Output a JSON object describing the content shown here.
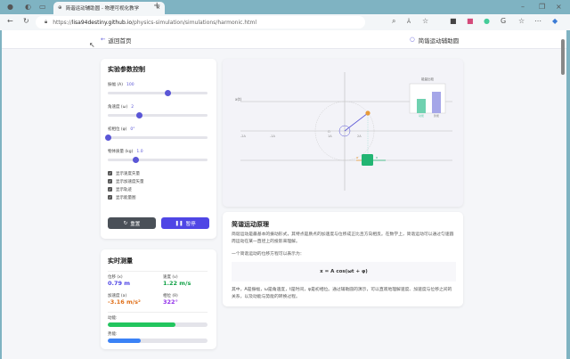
{
  "browser": {
    "tab_title": "简谐运动辅助圆 - 物理可视化教学",
    "url_prefix": "https://",
    "url_host": "lisa94destiny.github.io",
    "url_path": "/physics-simulation/simulations/harmonic.html"
  },
  "header": {
    "back_label": "返回首页",
    "title": "简谐运动辅助圆"
  },
  "controls": {
    "title": "实验参数控制",
    "sliders": [
      {
        "label": "振幅 (A)",
        "value": "100",
        "fraction": 0.6
      },
      {
        "label": "角速度 (ω)",
        "value": "2",
        "fraction": 0.32
      },
      {
        "label": "初相位 (φ)",
        "value": "0°",
        "fraction": 0.0
      },
      {
        "label": "物体质量 (kg)",
        "value": "1.0",
        "fraction": 0.28
      }
    ],
    "checkboxes": [
      {
        "label": "显示速度矢量",
        "checked": true
      },
      {
        "label": "显示加速度矢量",
        "checked": true
      },
      {
        "label": "显示轨迹",
        "checked": true
      },
      {
        "label": "显示能量图",
        "checked": true
      }
    ],
    "reset_label": "重置",
    "pause_label": "暂停"
  },
  "measure": {
    "title": "实时测量",
    "displacement": {
      "label": "位移 (x)",
      "value": "0.79 m"
    },
    "velocity": {
      "label": "速度 (v)",
      "value": "1.22 m/s"
    },
    "acceleration": {
      "label": "加速度 (a)",
      "value": "-3.16 m/s²"
    },
    "phase": {
      "label": "相位 (θ)",
      "value": "322°"
    },
    "kinetic": {
      "label": "动能:",
      "fraction": 0.68
    },
    "potential": {
      "label": "势能:",
      "fraction": 0.33
    }
  },
  "canvas": {
    "axis_label": "x(t)",
    "ticks": [
      "-2A",
      "-1A",
      "1A",
      "2A"
    ],
    "origin": "O",
    "energy_title": "能量比较",
    "energy_labels": [
      "动能",
      "势能"
    ],
    "vec_v": "v",
    "vec_a": "a",
    "colors": {
      "accent": "#5a56d6",
      "green": "#22b573",
      "orange": "#e89b3a"
    }
  },
  "principle": {
    "title": "简谐运动原理",
    "p1": "简谐运动是最基本的振动形式，其特点是质点的加速度与位移成正比且方向相反。在数学上，简谐运动可以通过匀速圆周运动在某一直径上的投影来理解。",
    "p2": "一个简谐运动的位移方程可以表示为：",
    "formula": "x = A cos(ωt + φ)",
    "p3": "其中，A是振幅，ω是角速度，t是时间，φ是初相位。通过辅助圆的演示，可以直观地理解速度、加速度与位移之间的关系，以及动能与势能的转换过程。"
  }
}
